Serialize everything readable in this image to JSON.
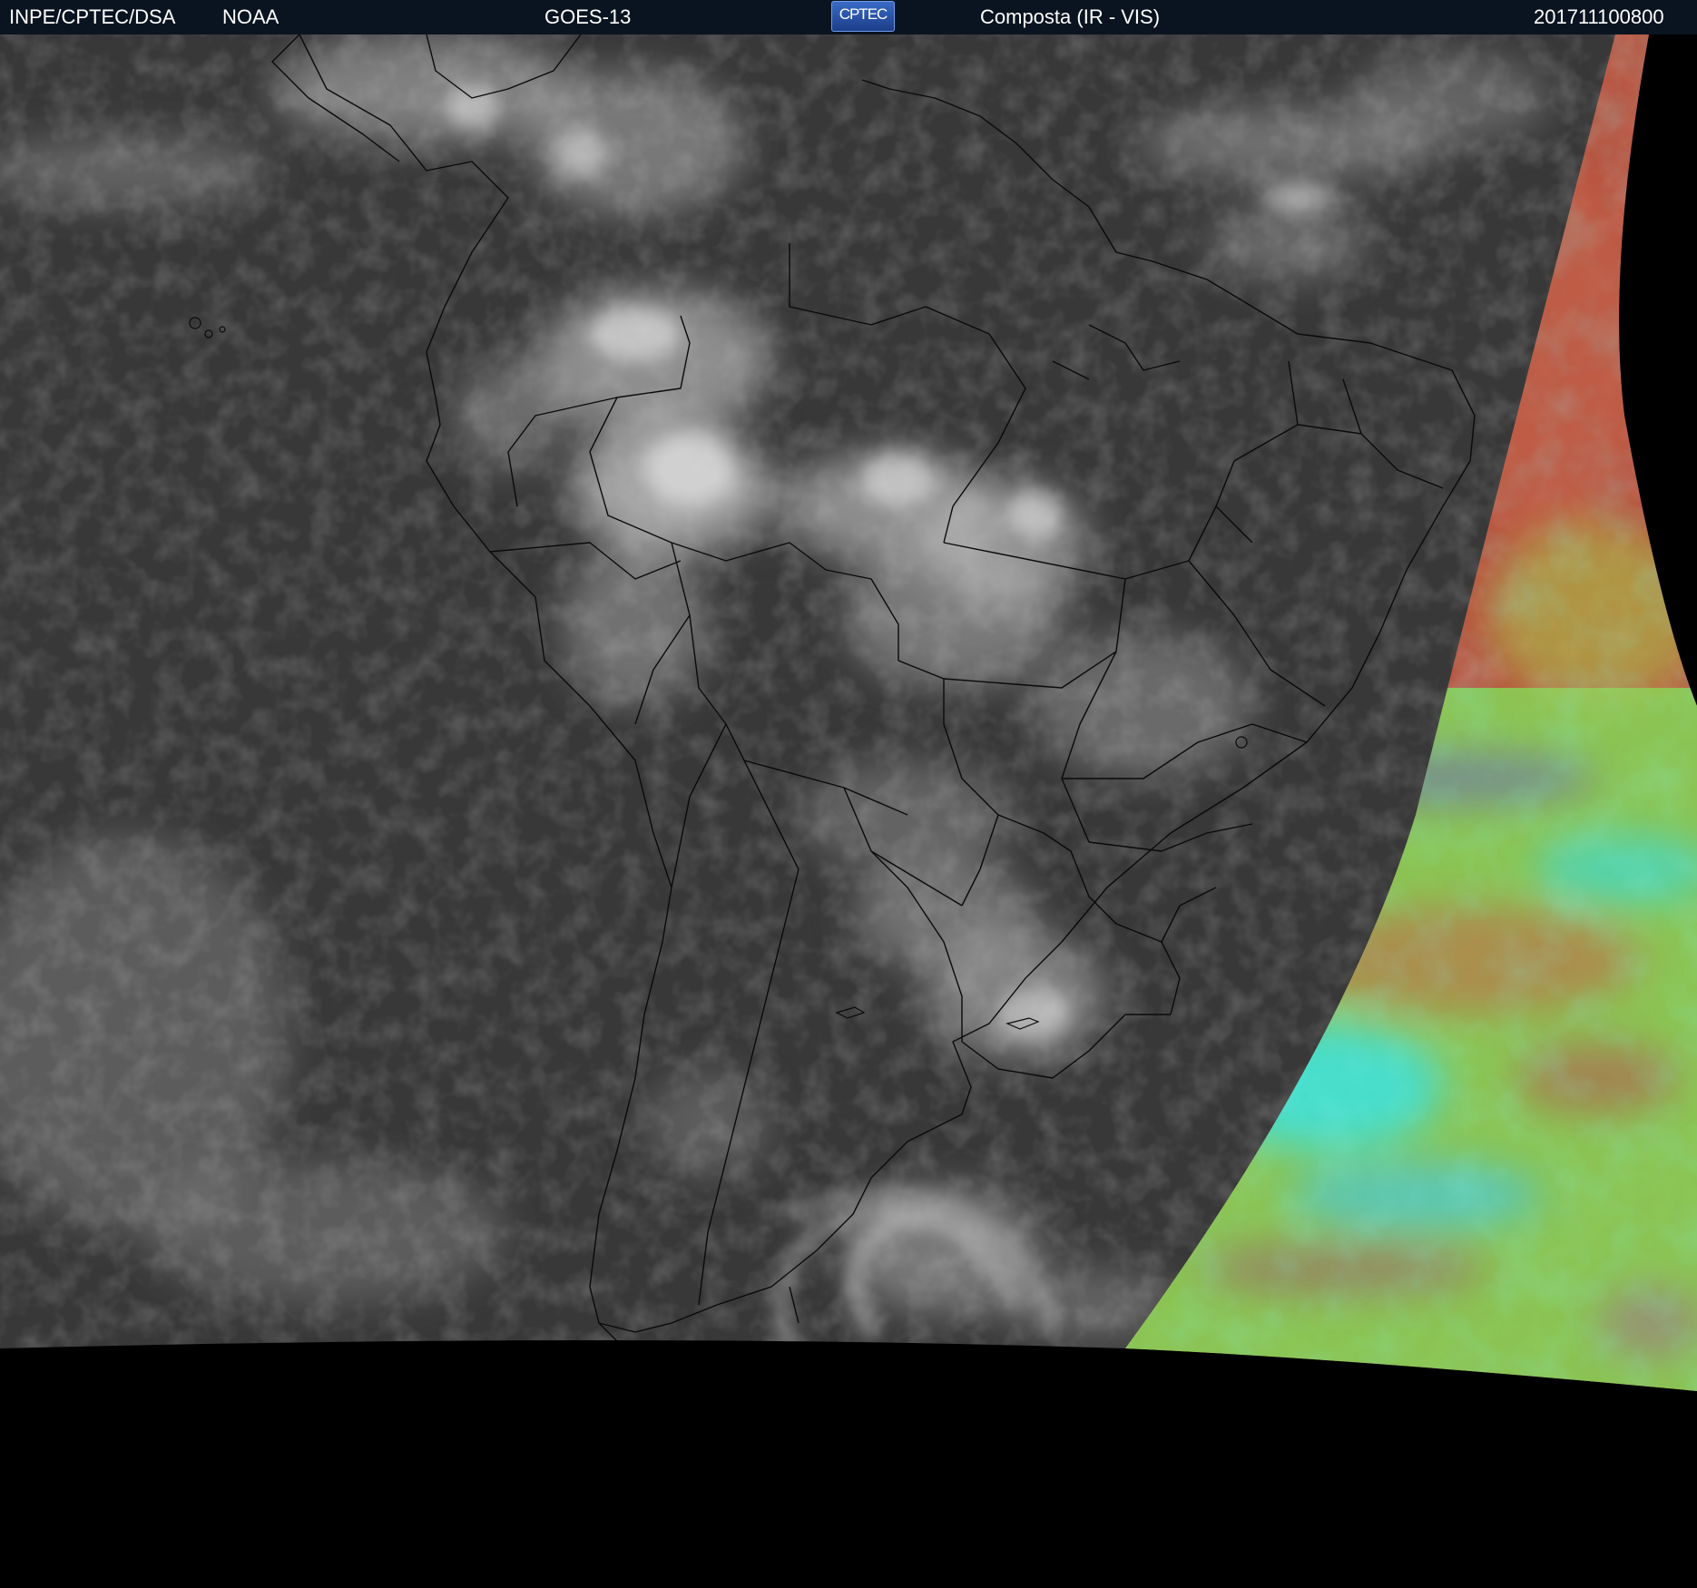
{
  "header": {
    "institution": "INPE/CPTEC/DSA",
    "agency": "NOAA",
    "satellite": "GOES-13",
    "logo_text": "CPTEC",
    "product": "Composta (IR - VIS)",
    "timestamp": "201711100800"
  },
  "colors": {
    "ir_background": "#3a3a3a",
    "cloud": "#d8d8d8",
    "space": "#000000",
    "vis_red": "#c0503c",
    "vis_green": "#8ee05a",
    "vis_cyan": "#40e0d8"
  }
}
